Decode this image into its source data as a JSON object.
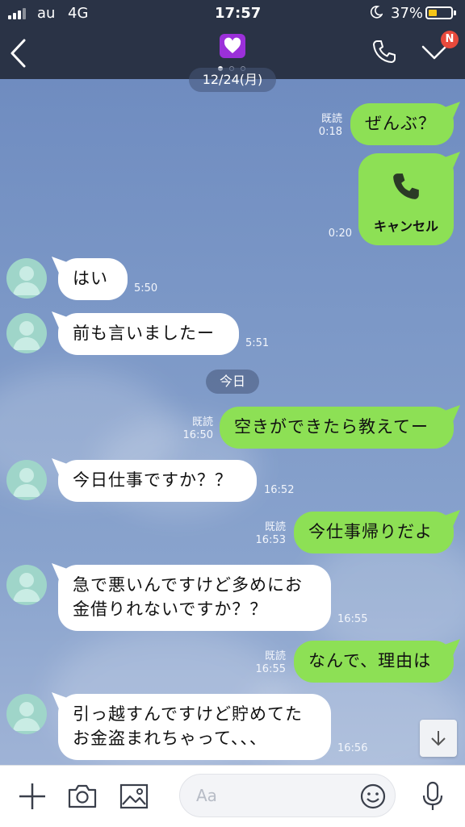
{
  "status_bar": {
    "carrier": "au",
    "network": "4G",
    "time": "17:57",
    "battery": "37%",
    "battery_level": 0.37
  },
  "header": {
    "badge": "N",
    "page_indicator": {
      "count": 3,
      "active": 0
    }
  },
  "messages": [
    {
      "type": "date",
      "text": "12/24(月)"
    },
    {
      "type": "out",
      "text": "ぜんぶ？",
      "read": "既読",
      "time": "0:18"
    },
    {
      "type": "out-call",
      "text": "キャンセル",
      "time": "0:20"
    },
    {
      "type": "in",
      "text": "はい",
      "time": "5:50"
    },
    {
      "type": "in",
      "text": "前も言いましたー",
      "time": "5:51"
    },
    {
      "type": "date",
      "text": "今日"
    },
    {
      "type": "out",
      "text": "空きができたら教えてー",
      "read": "既読",
      "time": "16:50"
    },
    {
      "type": "in",
      "text": "今日仕事ですか？？",
      "time": "16:52"
    },
    {
      "type": "out",
      "text": "今仕事帰りだよ",
      "read": "既読",
      "time": "16:53"
    },
    {
      "type": "in",
      "text": "急で悪いんですけど多めにお\n金借りれないですか？？",
      "time": "16:55"
    },
    {
      "type": "out",
      "text": "なんで、理由は",
      "read": "既読",
      "time": "16:55"
    },
    {
      "type": "in",
      "text": "引っ越すんですけど貯めてた\nお金盗まれちゃって、、、",
      "time": "16:56"
    }
  ],
  "input": {
    "placeholder": "Aa"
  },
  "colors": {
    "header_bg": "#2a3346",
    "chat_bg": "#7a95c3",
    "outgoing_bubble": "#8de055",
    "incoming_bubble": "#ffffff",
    "badge": "#e84a3c",
    "heart_tile": "#9b30d9"
  },
  "icons": {
    "back": "chevron-left-icon",
    "chat_icon": "purple-heart-icon",
    "call": "phone-icon",
    "menu": "chevron-down-icon",
    "add": "plus-icon",
    "camera": "camera-icon",
    "image": "image-icon",
    "emoji": "smiley-icon",
    "mic": "microphone-icon",
    "scroll": "arrow-down-icon"
  }
}
